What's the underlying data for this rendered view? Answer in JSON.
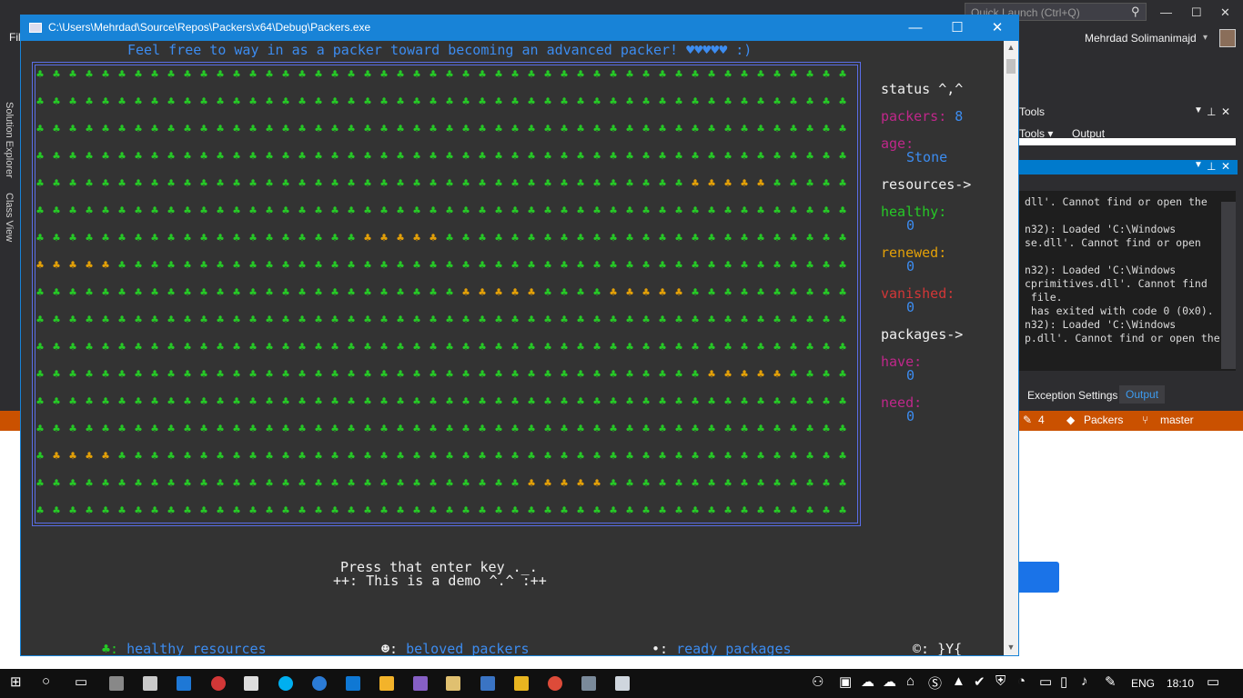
{
  "console": {
    "title": "C:\\Users\\Mehrdad\\Source\\Repos\\Packers\\x64\\Debug\\Packers.exe",
    "minimize": "—",
    "maximize": "☐",
    "close": "✕",
    "banner": "Feel free to way in as a packer toward becoming an advanced packer! ♥♥♥♥♥ :)",
    "field": {
      "columns": 50,
      "rows": 17,
      "glyph": "♣",
      "colors": {
        "healthy": "#26c926",
        "renewed": "#e3a008"
      },
      "renewed_segments": [
        {
          "row": 4,
          "start": 40,
          "length": 5
        },
        {
          "row": 6,
          "start": 20,
          "length": 5
        },
        {
          "row": 7,
          "start": 0,
          "length": 5
        },
        {
          "row": 8,
          "start": 26,
          "length": 5
        },
        {
          "row": 8,
          "start": 35,
          "length": 5
        },
        {
          "row": 11,
          "start": 41,
          "length": 5
        },
        {
          "row": 14,
          "start": 1,
          "length": 4
        },
        {
          "row": 15,
          "start": 30,
          "length": 5
        }
      ]
    },
    "status": {
      "heading": "status ^,^",
      "packers_label": "packers:",
      "packers_value": "8",
      "age_label": "age:",
      "age_value": "Stone",
      "resources_heading": "resources->",
      "healthy_label": "healthy:",
      "healthy_value": "0",
      "renewed_label": "renewed:",
      "renewed_value": "0",
      "vanished_label": "vanished:",
      "vanished_value": "0",
      "packages_heading": "packages->",
      "have_label": "have:",
      "have_value": "0",
      "need_label": "need:",
      "need_value": "0"
    },
    "prompt": "Press that enter key ._.",
    "demo": "++: This is a demo ^.^ :++",
    "legend": {
      "healthy_glyph": "♣:",
      "healthy_text": "healthy resources",
      "packers_glyph": "☻:",
      "packers_text": "beloved packers",
      "packages_glyph": "•:",
      "packages_text": "ready packages",
      "sign": "©: }Y{"
    }
  },
  "vs": {
    "file_menu": "Fil",
    "quick_launch": "Quick Launch (Ctrl+Q)",
    "user": "Mehrdad Solimanimajd",
    "side_tabs": [
      "Solution Explorer",
      "Class View"
    ],
    "pane_title": "Tools",
    "pane_tabs": [
      "Tools ▾",
      "Output"
    ],
    "output_lines": [
      "dll'. Cannot find or open the",
      "",
      "n32): Loaded 'C:\\Windows",
      "se.dll'. Cannot find or open",
      "",
      "n32): Loaded 'C:\\Windows",
      "cprimitives.dll'. Cannot find",
      " file.",
      " has exited with code 0 (0x0).",
      "n32): Loaded 'C:\\Windows",
      "p.dll'. Cannot find or open the"
    ],
    "bottom_tabs": [
      "Exception Settings",
      "Output"
    ],
    "status_bar": {
      "changes": "4",
      "repo": "Packers",
      "branch": "master"
    }
  },
  "taskbar": {
    "language": "ENG",
    "time": "18:10"
  }
}
